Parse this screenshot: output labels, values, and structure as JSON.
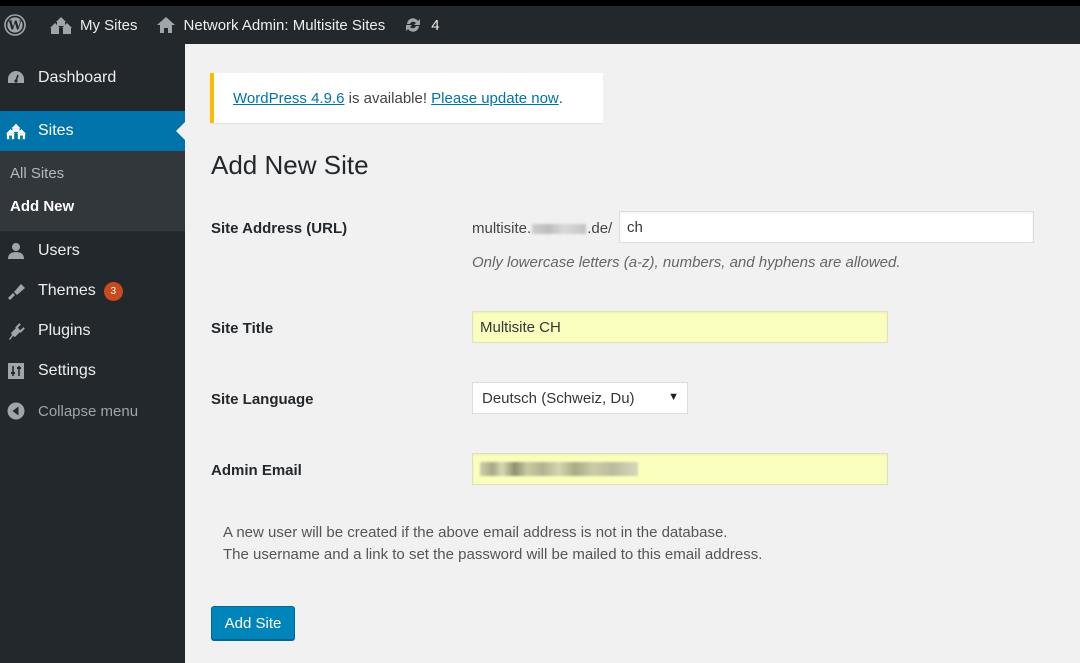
{
  "adminbar": {
    "wp_logo": "wordpress-logo-icon",
    "my_sites": {
      "label": "My Sites",
      "icon": "multisite-icon"
    },
    "network": {
      "label": "Network Admin: Multisite Sites",
      "icon": "home-icon"
    },
    "updates": {
      "count": "4",
      "icon": "update-icon"
    }
  },
  "sidebar": {
    "items": [
      {
        "label": "Dashboard",
        "icon": "dashboard-icon"
      },
      {
        "label": "Sites",
        "icon": "multisite-icon",
        "active": true
      },
      {
        "label": "Users",
        "icon": "users-icon"
      },
      {
        "label": "Themes",
        "icon": "brush-icon",
        "badge": "3"
      },
      {
        "label": "Plugins",
        "icon": "plugins-icon"
      },
      {
        "label": "Settings",
        "icon": "settings-icon"
      }
    ],
    "submenu": [
      {
        "label": "All Sites"
      },
      {
        "label": "Add New",
        "current": true
      }
    ],
    "collapse_label": "Collapse menu"
  },
  "notice": {
    "link1": "WordPress 4.9.6",
    "middle": " is available! ",
    "link2": "Please update now",
    "end": "."
  },
  "page": {
    "title": "Add New Site",
    "fields": {
      "site_address": {
        "label": "Site Address (URL)",
        "prefix_start": "multisite.",
        "prefix_end": ".de/",
        "value": "ch",
        "hint": "Only lowercase letters (a-z), numbers, and hyphens are allowed."
      },
      "site_title": {
        "label": "Site Title",
        "value": "Multisite CH"
      },
      "site_language": {
        "label": "Site Language",
        "selected": "Deutsch (Schweiz, Du)"
      },
      "admin_email": {
        "label": "Admin Email",
        "value": ""
      }
    },
    "info_line1": "A new user will be created if the above email address is not in the database.",
    "info_line2": "The username and a link to set the password will be mailed to this email address.",
    "submit_label": "Add Site"
  },
  "colors": {
    "adminbar_bg": "#23282d",
    "accent": "#0073aa",
    "button": "#0085ba",
    "notice_warning": "#ffb900",
    "badge": "#ca4a1f",
    "autofill": "#faffbd"
  }
}
